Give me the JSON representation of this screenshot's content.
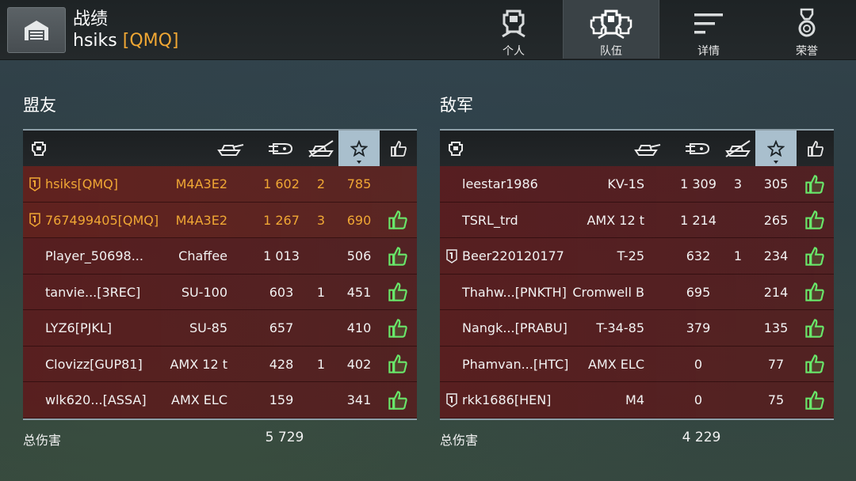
{
  "header": {
    "page_title": "战绩",
    "player_name": "hsiks",
    "player_clan": "[QMQ]"
  },
  "tabs": [
    {
      "label": "个人",
      "icon": "helmet-icon",
      "active": false
    },
    {
      "label": "队伍",
      "icon": "team-helmets-icon",
      "active": true
    },
    {
      "label": "详情",
      "icon": "details-list-icon",
      "active": false
    },
    {
      "label": "荣誉",
      "icon": "medal-icon",
      "active": false
    }
  ],
  "columns": {
    "player": "player-icon",
    "tank": "tank-icon",
    "damage": "damage-shell-icon",
    "kills": "kills-icon",
    "xp": "star-icon",
    "likes": "thumbs-up-icon"
  },
  "colors": {
    "clan_gold": "#f0a734",
    "row_red": "#5f1618",
    "like_green": "#69e86a",
    "sort_highlight": "#a9bfcd"
  },
  "allies": {
    "title": "盟友",
    "rows": [
      {
        "platoon": "1",
        "name": "hsiks[QMQ]",
        "tank": "M4A3E2",
        "damage": "1 602",
        "kills": "2",
        "xp": "785",
        "liked": false,
        "highlight": true
      },
      {
        "platoon": "1",
        "name": "767499405[QMQ]",
        "tank": "M4A3E2",
        "damage": "1 267",
        "kills": "3",
        "xp": "690",
        "liked": true,
        "highlight": true
      },
      {
        "platoon": "",
        "name": "Player_50698...",
        "tank": "Chaffee",
        "damage": "1 013",
        "kills": "",
        "xp": "506",
        "liked": true,
        "highlight": false
      },
      {
        "platoon": "",
        "name": "tanvie...[3REC]",
        "tank": "SU-100",
        "damage": "603",
        "kills": "1",
        "xp": "451",
        "liked": true,
        "highlight": false
      },
      {
        "platoon": "",
        "name": "LYZ6[PJKL]",
        "tank": "SU-85",
        "damage": "657",
        "kills": "",
        "xp": "410",
        "liked": true,
        "highlight": false
      },
      {
        "platoon": "",
        "name": "Clovizz[GUP81]",
        "tank": "AMX 12 t",
        "damage": "428",
        "kills": "1",
        "xp": "402",
        "liked": true,
        "highlight": false
      },
      {
        "platoon": "",
        "name": "wlk620...[ASSA]",
        "tank": "AMX ELC",
        "damage": "159",
        "kills": "",
        "xp": "341",
        "liked": true,
        "highlight": false
      }
    ],
    "total_label": "总伤害",
    "total_value": "5 729"
  },
  "enemies": {
    "title": "敌军",
    "rows": [
      {
        "platoon": "",
        "name": "leestar1986",
        "tank": "KV-1S",
        "damage": "1 309",
        "kills": "3",
        "xp": "305",
        "liked": true,
        "highlight": false
      },
      {
        "platoon": "",
        "name": "TSRL_trd",
        "tank": "AMX 12 t",
        "damage": "1 214",
        "kills": "",
        "xp": "265",
        "liked": true,
        "highlight": false
      },
      {
        "platoon": "1",
        "name": "Beer220120177",
        "tank": "T-25",
        "damage": "632",
        "kills": "1",
        "xp": "234",
        "liked": true,
        "highlight": false
      },
      {
        "platoon": "",
        "name": "Thahw...[PNKTH]",
        "tank": "Cromwell B",
        "damage": "695",
        "kills": "",
        "xp": "214",
        "liked": true,
        "highlight": false
      },
      {
        "platoon": "",
        "name": "Nangk...[PRABU]",
        "tank": "T-34-85",
        "damage": "379",
        "kills": "",
        "xp": "135",
        "liked": true,
        "highlight": false
      },
      {
        "platoon": "",
        "name": "Phamvan...[HTC]",
        "tank": "AMX ELC",
        "damage": "0",
        "kills": "",
        "xp": "77",
        "liked": true,
        "highlight": false
      },
      {
        "platoon": "1",
        "name": "rkk1686[HEN]",
        "tank": "M4",
        "damage": "0",
        "kills": "",
        "xp": "75",
        "liked": true,
        "highlight": false
      }
    ],
    "total_label": "总伤害",
    "total_value": "4 229"
  }
}
